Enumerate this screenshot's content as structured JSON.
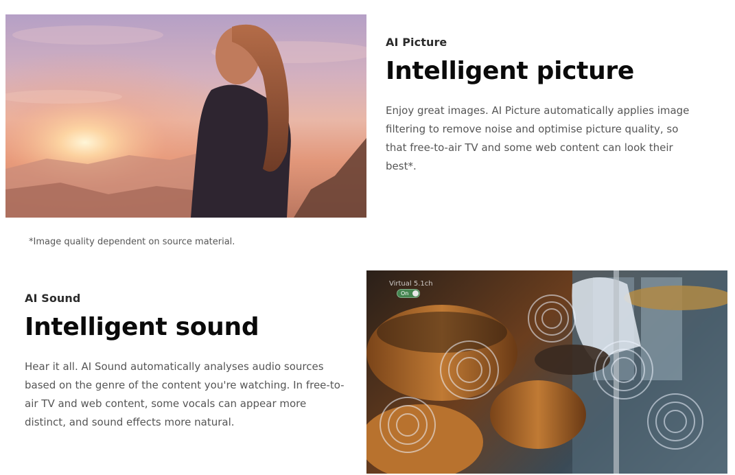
{
  "ai_picture": {
    "eyebrow": "AI Picture",
    "headline": "Intelligent picture",
    "body": "Enjoy great images. AI Picture automatically applies image filtering to remove noise and optimise picture quality, so that free-to-air TV and some web content can look their best*.",
    "image_icon": "sunset-portrait-photo"
  },
  "footnote": "*Image quality dependent on source material.",
  "ai_sound": {
    "eyebrow": "AI Sound",
    "headline": "Intelligent sound",
    "body": "Hear it all. AI Sound automatically analyses audio sources based on the genre of the content you're watching. In free-to-air TV and web content, some vocals can appear more distinct, and sound effects more natural.",
    "image_icon": "drummer-sound-waves-photo",
    "overlay": {
      "label": "Virtual 5.1ch",
      "toggle_text": "On"
    }
  },
  "colors": {
    "headline": "#0a0a0a",
    "body": "#555555",
    "toggle_on": "#46965a"
  }
}
